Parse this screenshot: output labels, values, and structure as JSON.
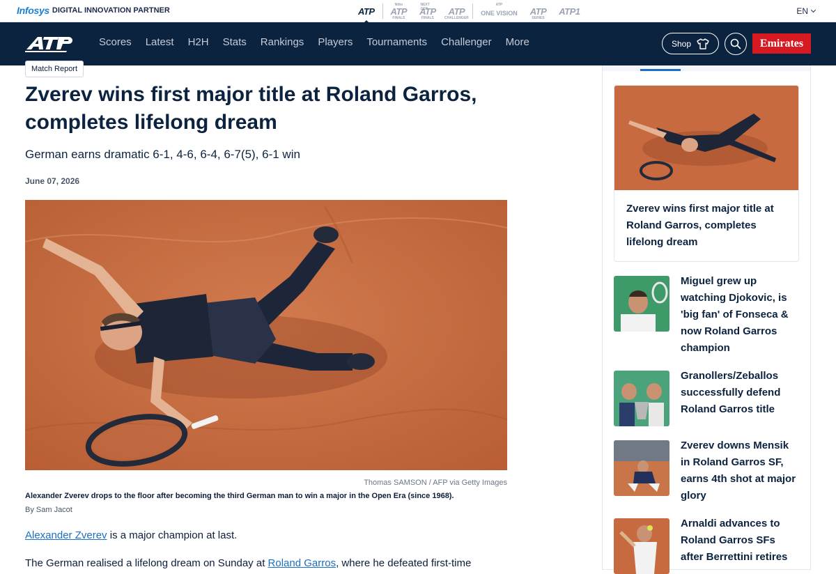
{
  "partner": {
    "logo": "Infosys",
    "label": "DIGITAL INNOVATION PARTNER"
  },
  "brands": {
    "atp": "ATP",
    "finals_top": "Nitto",
    "finals": "ATP",
    "finals_sub": "FINALS",
    "nextgen_top": "NEXT GEN",
    "nextgen": "ATP",
    "nextgen_sub": "FINALS",
    "challenger": "ATP",
    "challenger_sub": "CHALLENGER",
    "onevision": "ONE VISION",
    "onevision_top": "ATP",
    "series": "ATP",
    "series_sub": "SERIES",
    "atp1": "ATP1"
  },
  "language": "EN",
  "nav": {
    "items": [
      "Scores",
      "Latest",
      "H2H",
      "Stats",
      "Rankings",
      "Players",
      "Tournaments",
      "Challenger",
      "More"
    ],
    "shop": "Shop",
    "sponsor": "Emirates"
  },
  "article": {
    "tag": "Match Report",
    "headline": "Zverev wins first major title at Roland Garros, completes lifelong dream",
    "subhead": "German earns dramatic 6-1, 4-6, 6-4, 6-7(5), 6-1 win",
    "date": "June 07, 2026",
    "photo_credit": "Thomas SAMSON / AFP via Getty Images",
    "caption": "Alexander Zverev drops to the floor after becoming the third German man to win a major in the Open Era (since 1968).",
    "byline": "By Sam Jacot",
    "p1_link": "Alexander Zverev",
    "p1_text": " is a major champion at last.",
    "p2_text_a": "The German realised a lifelong dream on Sunday at ",
    "p2_link": "Roland Garros",
    "p2_text_b": ", where he defeated first-time"
  },
  "sidebar": {
    "featured_title": "Zverev wins first major title at Roland Garros, completes lifelong dream",
    "items": [
      {
        "title": "Miguel grew up watching Djokovic, is 'big fan' of Fonseca & now Roland Garros champion"
      },
      {
        "title": "Granollers/Zeballos successfully defend Roland Garros title"
      },
      {
        "title": "Zverev downs Mensik in Roland Garros SF, earns 4th shot at major glory"
      },
      {
        "title": "Arnaldi advances to Roland Garros SFs after Berrettini retires"
      }
    ]
  },
  "colors": {
    "navy": "#0c2340",
    "clay": "#c86a3f",
    "link": "#1a6fc4",
    "emirates_red": "#d71921"
  }
}
